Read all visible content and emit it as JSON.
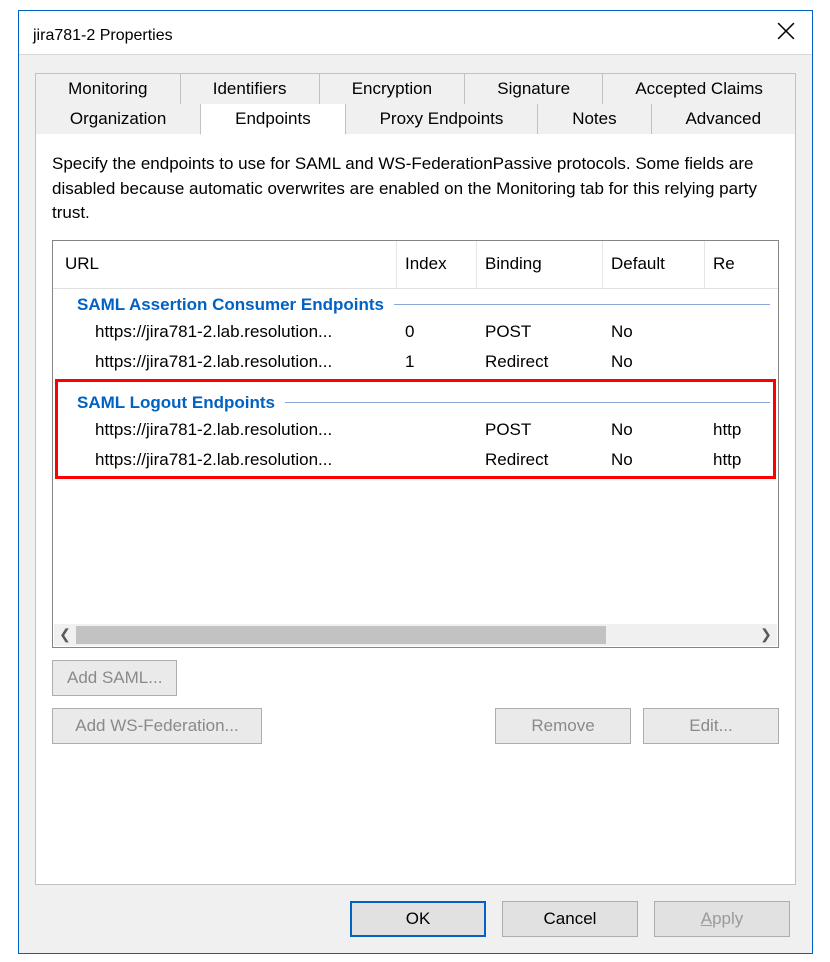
{
  "window": {
    "title": "jira781-2 Properties",
    "close_aria": "Close"
  },
  "tabs_row1": [
    {
      "label": "Monitoring"
    },
    {
      "label": "Identifiers"
    },
    {
      "label": "Encryption"
    },
    {
      "label": "Signature"
    },
    {
      "label": "Accepted Claims"
    }
  ],
  "tabs_row2": [
    {
      "label": "Organization"
    },
    {
      "label": "Endpoints",
      "active": true
    },
    {
      "label": "Proxy Endpoints"
    },
    {
      "label": "Notes"
    },
    {
      "label": "Advanced"
    }
  ],
  "panel": {
    "description": "Specify the endpoints to use for SAML and WS-FederationPassive protocols. Some fields are disabled because automatic overwrites are enabled on the Monitoring tab for this relying party trust."
  },
  "columns": {
    "url": "URL",
    "index": "Index",
    "binding": "Binding",
    "default": "Default",
    "response": "Re"
  },
  "groups": [
    {
      "title": "SAML Assertion Consumer Endpoints",
      "rows": [
        {
          "url": "https://jira781-2.lab.resolution...",
          "index": "0",
          "binding": "POST",
          "default": "No",
          "response": ""
        },
        {
          "url": "https://jira781-2.lab.resolution...",
          "index": "1",
          "binding": "Redirect",
          "default": "No",
          "response": ""
        }
      ]
    },
    {
      "title": "SAML Logout Endpoints",
      "highlighted": true,
      "rows": [
        {
          "url": "https://jira781-2.lab.resolution...",
          "index": "",
          "binding": "POST",
          "default": "No",
          "response": "http"
        },
        {
          "url": "https://jira781-2.lab.resolution...",
          "index": "",
          "binding": "Redirect",
          "default": "No",
          "response": "http"
        }
      ]
    }
  ],
  "panel_buttons": {
    "add_saml": "Add SAML...",
    "add_wsfed": "Add WS-Federation...",
    "remove": "Remove",
    "edit": "Edit..."
  },
  "dialog_buttons": {
    "ok": "OK",
    "cancel": "Cancel",
    "apply_prefix": "A",
    "apply_rest": "pply"
  }
}
